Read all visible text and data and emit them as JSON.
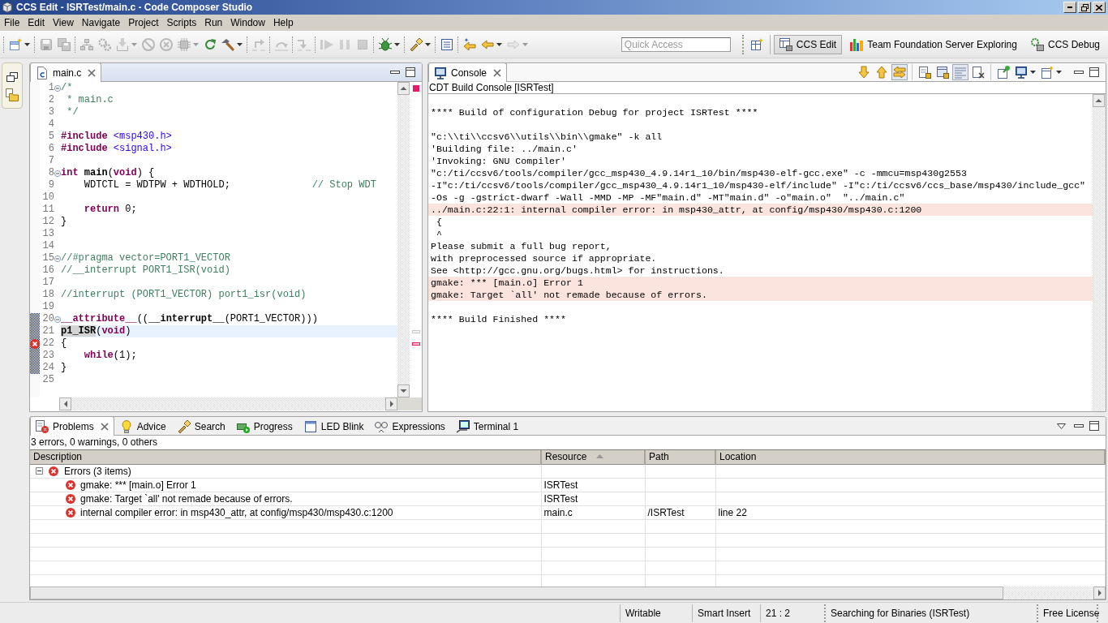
{
  "window": {
    "title": "CCS Edit - ISRTest/main.c - Code Composer Studio"
  },
  "menu": [
    "File",
    "Edit",
    "View",
    "Navigate",
    "Project",
    "Scripts",
    "Run",
    "Window",
    "Help"
  ],
  "toolbar": [
    [
      {
        "kind": "new",
        "disabled": false,
        "menu": true
      }
    ],
    [
      {
        "kind": "save",
        "disabled": true,
        "menu": false
      },
      {
        "kind": "saveall",
        "disabled": true,
        "menu": false
      }
    ],
    [
      {
        "kind": "connect",
        "disabled": true,
        "menu": false
      },
      {
        "kind": "gears",
        "disabled": true,
        "menu": false
      },
      {
        "kind": "load",
        "disabled": true,
        "menu": true
      },
      {
        "kind": "nodebug",
        "disabled": true,
        "menu": false
      },
      {
        "kind": "noclear",
        "disabled": true,
        "menu": false
      },
      {
        "kind": "chip",
        "disabled": true,
        "menu": true
      },
      {
        "kind": "restart",
        "disabled": false,
        "menu": false
      },
      {
        "kind": "build",
        "disabled": false,
        "menu": true
      }
    ],
    [
      {
        "kind": "stepreturn",
        "disabled": true,
        "menu": false
      }
    ],
    [
      {
        "kind": "stepover",
        "disabled": true,
        "menu": false
      }
    ],
    [
      {
        "kind": "stepinto",
        "disabled": true,
        "menu": false
      }
    ],
    [
      {
        "kind": "resume",
        "disabled": true,
        "menu": false
      },
      {
        "kind": "suspend",
        "disabled": true,
        "menu": false
      },
      {
        "kind": "terminate",
        "disabled": true,
        "menu": false
      }
    ],
    [
      {
        "kind": "debug",
        "disabled": false,
        "menu": true
      }
    ],
    [
      {
        "kind": "flash",
        "disabled": false,
        "menu": true
      }
    ],
    [
      {
        "kind": "outline",
        "disabled": false,
        "menu": false
      }
    ],
    [
      {
        "kind": "lastedit",
        "disabled": false,
        "menu": false
      },
      {
        "kind": "back",
        "disabled": false,
        "menu": true
      },
      {
        "kind": "forward",
        "disabled": true,
        "menu": true
      }
    ]
  ],
  "quick_access": {
    "placeholder": "Quick Access"
  },
  "perspectives": [
    {
      "label": "CCS Edit",
      "selected": true
    },
    {
      "label": "Team Foundation Server Exploring",
      "selected": false
    },
    {
      "label": "CCS Debug",
      "selected": false
    }
  ],
  "editor": {
    "tabs": [
      {
        "label": "main.c",
        "selected": true
      }
    ],
    "lines": [
      {
        "number": "1",
        "fold": true,
        "range": false,
        "error": false,
        "current": false,
        "tokens": [
          {
            "kind": "comment",
            "text": "/*"
          }
        ]
      },
      {
        "number": "2",
        "fold": false,
        "range": false,
        "error": false,
        "current": false,
        "tokens": [
          {
            "kind": "comment",
            "text": " * main.c"
          }
        ]
      },
      {
        "number": "3",
        "fold": false,
        "range": false,
        "error": false,
        "current": false,
        "tokens": [
          {
            "kind": "comment",
            "text": " */"
          }
        ]
      },
      {
        "number": "4",
        "fold": false,
        "range": false,
        "error": false,
        "current": false
      },
      {
        "number": "5",
        "fold": false,
        "range": false,
        "error": false,
        "current": false,
        "tokens": [
          {
            "kind": "keyword",
            "text": "#include"
          },
          {
            "kind": "string",
            "text": " <msp430.h>"
          }
        ]
      },
      {
        "number": "6",
        "fold": false,
        "range": false,
        "error": false,
        "current": false,
        "tokens": [
          {
            "kind": "keyword",
            "text": "#include"
          },
          {
            "kind": "string",
            "text": " <signal.h>"
          }
        ]
      },
      {
        "number": "7",
        "fold": false,
        "range": false,
        "error": false,
        "current": false
      },
      {
        "number": "8",
        "fold": true,
        "range": false,
        "error": false,
        "current": false,
        "tokens": [
          {
            "kind": "keyword",
            "text": "int"
          },
          {
            "kind": "bold",
            "text": " main"
          },
          {
            "kind": "plain",
            "text": "("
          },
          {
            "kind": "keyword",
            "text": "void"
          },
          {
            "kind": "plain",
            "text": ") {"
          }
        ]
      },
      {
        "number": "9",
        "fold": false,
        "range": false,
        "error": false,
        "current": false,
        "tokens": [
          {
            "kind": "plain",
            "text": "    WDTCTL = WDTPW + WDTHOLD;"
          },
          {
            "kind": "comment",
            "text": "              // Stop WDT"
          }
        ]
      },
      {
        "number": "10",
        "fold": false,
        "range": false,
        "error": false,
        "current": false
      },
      {
        "number": "11",
        "fold": false,
        "range": false,
        "error": false,
        "current": false,
        "tokens": [
          {
            "kind": "keyword",
            "text": "    return"
          },
          {
            "kind": "plain",
            "text": " 0;"
          }
        ]
      },
      {
        "number": "12",
        "fold": false,
        "range": false,
        "error": false,
        "current": false,
        "tokens": [
          {
            "kind": "plain",
            "text": "}"
          }
        ]
      },
      {
        "number": "13",
        "fold": false,
        "range": false,
        "error": false,
        "current": false
      },
      {
        "number": "14",
        "fold": false,
        "range": false,
        "error": false,
        "current": false
      },
      {
        "number": "15",
        "fold": true,
        "range": false,
        "error": false,
        "current": false,
        "tokens": [
          {
            "kind": "comment",
            "text": "//#pragma vector=PORT1_VECTOR"
          }
        ]
      },
      {
        "number": "16",
        "fold": false,
        "range": false,
        "error": false,
        "current": false,
        "tokens": [
          {
            "kind": "comment",
            "text": "//__interrupt PORT1_ISR(void)"
          }
        ]
      },
      {
        "number": "17",
        "fold": false,
        "range": false,
        "error": false,
        "current": false
      },
      {
        "number": "18",
        "fold": false,
        "range": false,
        "error": false,
        "current": false,
        "tokens": [
          {
            "kind": "comment",
            "text": "//interrupt (PORT1_VECTOR) port1_isr(void)"
          }
        ]
      },
      {
        "number": "19",
        "fold": false,
        "range": false,
        "error": false,
        "current": false
      },
      {
        "number": "20",
        "fold": true,
        "range": true,
        "error": false,
        "current": false,
        "tokens": [
          {
            "kind": "keyword",
            "text": "__attribute__"
          },
          {
            "kind": "plain",
            "text": "(("
          },
          {
            "kind": "bold",
            "text": "__interrupt__"
          },
          {
            "kind": "plain",
            "text": "(PORT1_VECTOR)))"
          }
        ]
      },
      {
        "number": "21",
        "fold": false,
        "range": true,
        "error": false,
        "current": true,
        "tokens": [
          {
            "kind": "occurrence",
            "text": "p1_ISR"
          },
          {
            "kind": "plain",
            "text": "("
          },
          {
            "kind": "keyword",
            "text": "void"
          },
          {
            "kind": "plain",
            "text": ")"
          }
        ]
      },
      {
        "number": "22",
        "fold": false,
        "range": true,
        "error": true,
        "current": false,
        "tokens": [
          {
            "kind": "plain",
            "text": "{"
          }
        ]
      },
      {
        "number": "23",
        "fold": false,
        "range": true,
        "error": false,
        "current": false,
        "tokens": [
          {
            "kind": "keyword",
            "text": "    while"
          },
          {
            "kind": "plain",
            "text": "(1);"
          }
        ]
      },
      {
        "number": "24",
        "fold": false,
        "range": true,
        "error": false,
        "current": false,
        "tokens": [
          {
            "kind": "plain",
            "text": "}"
          }
        ]
      },
      {
        "number": "25",
        "fold": false,
        "range": false,
        "error": false,
        "current": false
      }
    ]
  },
  "console": {
    "tabs": [
      {
        "label": "Console",
        "selected": true
      }
    ],
    "tools": [
      [
        {
          "kind": "next",
          "on": false,
          "menu": false
        },
        {
          "kind": "previous",
          "on": false,
          "menu": false
        },
        {
          "kind": "link",
          "on": true,
          "menu": false
        }
      ],
      [
        {
          "kind": "lock",
          "on": false,
          "menu": false
        },
        {
          "kind": "scrolllock",
          "on": false,
          "menu": false
        },
        {
          "kind": "wrap",
          "on": true,
          "menu": false
        },
        {
          "kind": "clear",
          "on": false,
          "menu": false
        }
      ],
      [
        {
          "kind": "pin",
          "on": false,
          "menu": false
        },
        {
          "kind": "display",
          "on": false,
          "menu": true
        },
        {
          "kind": "newconsole",
          "on": false,
          "menu": true
        }
      ]
    ],
    "subtitle": "CDT Build Console [ISRTest]",
    "blocks": [
      [
        {
          "text": "**** Build of configuration Debug for project ISRTest ****",
          "error": false
        }
      ],
      [
        {
          "text": "\"c:\\\\ti\\\\ccsv6\\\\utils\\\\bin\\\\gmake\" -k all",
          "error": false
        },
        {
          "text": "'Building file: ../main.c'",
          "error": false
        },
        {
          "text": "'Invoking: GNU Compiler'",
          "error": false
        },
        {
          "text": "\"c:/ti/ccsv6/tools/compiler/gcc_msp430_4.9.14r1_10/bin/msp430-elf-gcc.exe\" -c -mmcu=msp430g2553",
          "error": false
        },
        {
          "text": "-I\"c:/ti/ccsv6/tools/compiler/gcc_msp430_4.9.14r1_10/msp430-elf/include\" -I\"c:/ti/ccsv6/ccs_base/msp430/include_gcc\"",
          "error": false
        },
        {
          "text": "-Os -g -gstrict-dwarf -Wall -MMD -MP -MF\"main.d\" -MT\"main.d\" -o\"main.o\"  \"../main.c\"",
          "error": false
        },
        {
          "text": "../main.c:22:1: internal compiler error: in msp430_attr, at config/msp430/msp430.c:1200",
          "error": true
        },
        {
          "text": " {",
          "error": false
        },
        {
          "text": " ^",
          "error": false
        },
        {
          "text": "Please submit a full bug report,",
          "error": false
        },
        {
          "text": "with preprocessed source if appropriate.",
          "error": false
        },
        {
          "text": "See <http://gcc.gnu.org/bugs.html> for instructions.",
          "error": false
        },
        {
          "text": "gmake: *** [main.o] Error 1",
          "error": true
        },
        {
          "text": "gmake: Target `all' not remade because of errors.",
          "error": true
        }
      ],
      [
        {
          "text": "**** Build Finished ****",
          "error": false
        }
      ]
    ]
  },
  "problems": {
    "tabs": [
      {
        "label": "Problems",
        "selected": true
      },
      {
        "label": "Advice",
        "selected": false
      },
      {
        "label": "Search",
        "selected": false
      },
      {
        "label": "Progress",
        "selected": false
      },
      {
        "label": "LED Blink",
        "selected": false
      },
      {
        "label": "Expressions",
        "selected": false
      },
      {
        "label": "Terminal 1",
        "selected": false
      }
    ],
    "summary": "3 errors, 0 warnings, 0 others",
    "columns": [
      {
        "label": "Description",
        "sorted": false
      },
      {
        "label": "Resource",
        "sorted": true
      },
      {
        "label": "Path",
        "sorted": false
      },
      {
        "label": "Location",
        "sorted": false
      }
    ],
    "groups": [
      {
        "label": "Errors (3 items)",
        "expanded": true,
        "children": [
          {
            "description": "gmake: *** [main.o] Error 1",
            "resource": "ISRTest"
          },
          {
            "description": "gmake: Target `all' not remade because of errors.",
            "resource": "ISRTest"
          },
          {
            "description": "internal compiler error: in msp430_attr, at config/msp430/msp430.c:1200",
            "resource": "main.c",
            "path": "/ISRTest",
            "location": "line 22"
          }
        ]
      }
    ]
  },
  "status_bar": [
    "Writable",
    "Smart Insert",
    "21 : 2",
    "Searching for Binaries (ISRTest)",
    "Free License"
  ]
}
